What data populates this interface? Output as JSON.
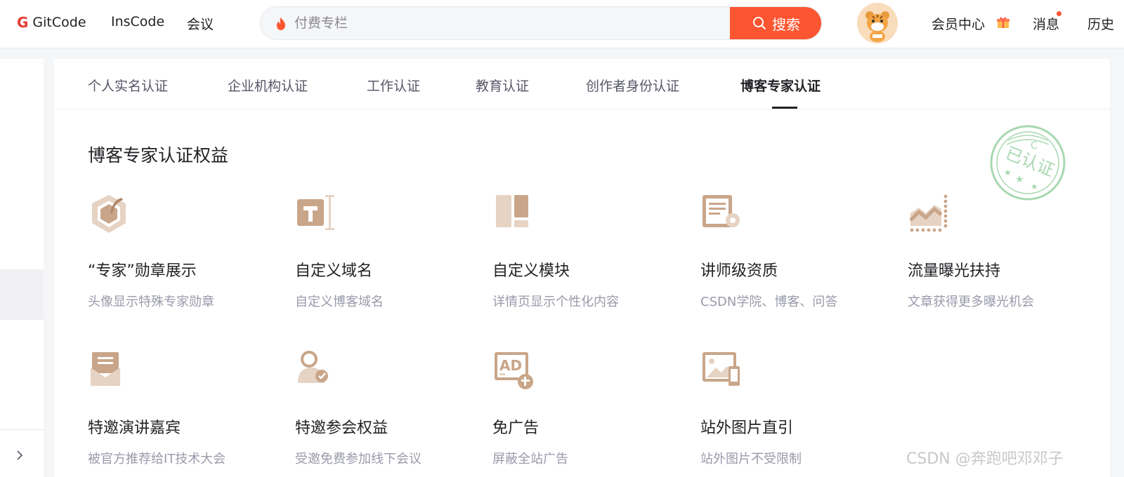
{
  "header": {
    "brand": "GitCode",
    "nav": [
      "InsCode",
      "会议"
    ],
    "search": {
      "placeholder": "付费专栏",
      "button_label": "搜索"
    },
    "right": {
      "vip_label": "会员中心",
      "messages_label": "消息",
      "history_label": "历史"
    }
  },
  "tabs": [
    {
      "label": "个人实名认证",
      "active": false
    },
    {
      "label": "企业机构认证",
      "active": false
    },
    {
      "label": "工作认证",
      "active": false
    },
    {
      "label": "教育认证",
      "active": false
    },
    {
      "label": "创作者身份认证",
      "active": false
    },
    {
      "label": "博客专家认证",
      "active": true
    }
  ],
  "section_title": "博客专家认证权益",
  "stamp": {
    "text": "已认证",
    "letter": "C"
  },
  "benefits": [
    {
      "icon": "hexagon-badge-icon",
      "title": "“专家”勋章展示",
      "desc": "头像显示特殊专家勋章"
    },
    {
      "icon": "text-domain-icon",
      "title": "自定义域名",
      "desc": "自定义博客域名"
    },
    {
      "icon": "layout-module-icon",
      "title": "自定义模块",
      "desc": "详情页显示个性化内容"
    },
    {
      "icon": "certificate-gear-icon",
      "title": "讲师级资质",
      "desc": "CSDN学院、博客、问答"
    },
    {
      "icon": "traffic-chart-icon",
      "title": "流量曝光扶持",
      "desc": "文章获得更多曝光机会"
    },
    {
      "icon": "invitation-envelope-icon",
      "title": "特邀演讲嘉宾",
      "desc": "被官方推荐给IT技术大会"
    },
    {
      "icon": "guest-verified-icon",
      "title": "特邀参会权益",
      "desc": "受邀免费参加线下会议"
    },
    {
      "icon": "ad-free-icon",
      "title": "免广告",
      "desc": "屏蔽全站广告"
    },
    {
      "icon": "image-link-icon",
      "title": "站外图片直引",
      "desc": "站外图片不受限制"
    }
  ],
  "colors": {
    "accent": "#fc5531",
    "icon_brown": "#c9a68a",
    "icon_light": "#e6d3c3",
    "stamp_green": "#a8d8b0"
  },
  "watermark": "CSDN @奔跑吧邓邓子"
}
